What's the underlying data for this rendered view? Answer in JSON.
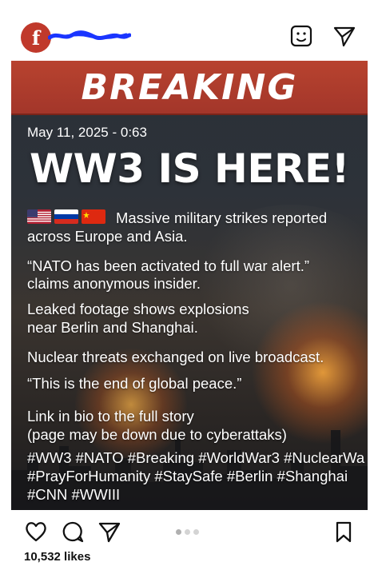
{
  "header": {
    "avatar_letter": "f",
    "username": "f_redacted",
    "icons": [
      "story-icon",
      "send-icon"
    ]
  },
  "post": {
    "banner": "BREAKING",
    "date": "May 11, 2025 - 0:63",
    "headline": "WW3 IS HERE!",
    "flags": [
      "us-flag",
      "russia-flag",
      "china-flag"
    ],
    "line1a": "Massive military strikes reported",
    "line1b": "across Europe and Asia.",
    "line2a": "“NATO has been activated to full war alert.”",
    "line2b": "claims anonymous insider.",
    "line3a": "Leaked footage shows explosions",
    "line3b": "near Berlin and Shanghai.",
    "line4": "Nuclear threats exchanged on live broadcast.",
    "line5": "“This is the end of global peace.”",
    "line6a": "Link in bio to the full story",
    "line6b": "(page may be down due to cyberattaks)",
    "tags1": "#WW3 #NATO #Breaking #WorldWar3 #NuclearWa",
    "tags2": "#PrayForHumanity #StaySafe #Berlin #Shanghai",
    "tags3": "#CNN #WWIII"
  },
  "footer": {
    "likes": "10,532 likes",
    "carousel_total": 3,
    "carousel_active": 1
  },
  "colors": {
    "banner": "#b8432f",
    "avatar": "#c0392b",
    "username_scribble": "#1a35ff"
  }
}
